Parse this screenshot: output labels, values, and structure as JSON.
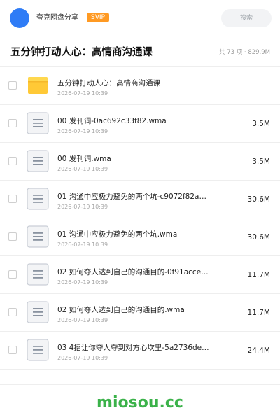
{
  "header": {
    "share_name": "夸克网盘分享",
    "badge": "SVIP",
    "search_label": "搜索"
  },
  "folder": {
    "title": "五分钟打动人心：高情商沟通课",
    "meta": "共 73 项 · 829.9M"
  },
  "files": [
    {
      "type": "folder",
      "name": "五分钟打动人心：高情商沟通课",
      "date": "2026-07-19 10:39",
      "size": ""
    },
    {
      "type": "file",
      "name": "00 发刊词-0ac692c33f82.wma",
      "date": "2026-07-19 10:39",
      "size": "3.5M"
    },
    {
      "type": "file",
      "name": "00 发刊词.wma",
      "date": "2026-07-19 10:39",
      "size": "3.5M"
    },
    {
      "type": "file",
      "name": "01 沟通中应极力避免的两个坑-c9072f82a…",
      "date": "2026-07-19 10:39",
      "size": "30.6M"
    },
    {
      "type": "file",
      "name": "01 沟通中应极力避免的两个坑.wma",
      "date": "2026-07-19 10:39",
      "size": "30.6M"
    },
    {
      "type": "file",
      "name": "02 如何夺人达到自己的沟通目的-0f91acce…",
      "date": "2026-07-19 10:39",
      "size": "11.7M"
    },
    {
      "type": "file",
      "name": "02 如何夺人达到自己的沟通目的.wma",
      "date": "2026-07-19 10:39",
      "size": "11.7M"
    },
    {
      "type": "file",
      "name": "03 4招让你夺人夺到对方心坎里-5a2736de…",
      "date": "2026-07-19 10:39",
      "size": "24.4M"
    }
  ],
  "watermark": "miosou.cc",
  "colors": {
    "avatar": "#2f7cf6",
    "svip_badge": "#ff9a23",
    "folder_icon": "#ffc936",
    "watermark": "#3bb24a"
  },
  "icons": {
    "folder": "folder-icon",
    "file": "file-doc-icon"
  }
}
